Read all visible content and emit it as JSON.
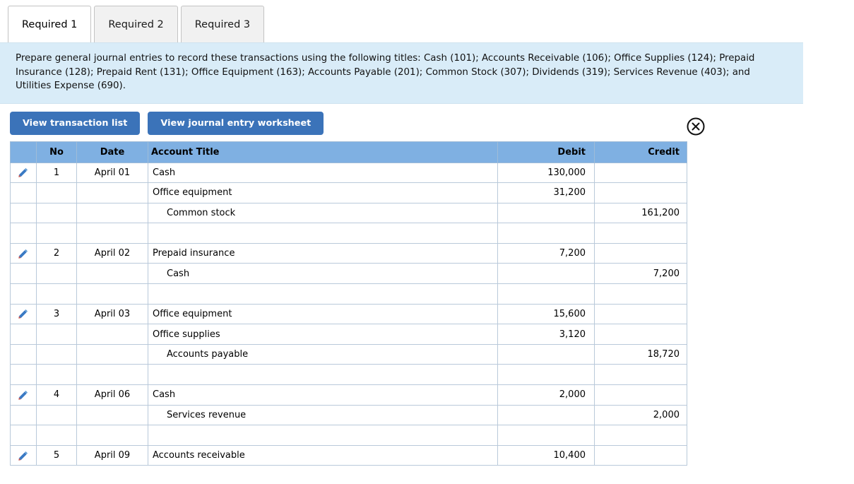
{
  "tabs": [
    {
      "label": "Required 1",
      "active": true
    },
    {
      "label": "Required 2",
      "active": false
    },
    {
      "label": "Required 3",
      "active": false
    }
  ],
  "instructions": {
    "text": "Prepare general journal entries to record these transactions using the following titles: Cash (101); Accounts Receivable (106); Office Supplies (124); Prepaid Insurance (128); Prepaid Rent (131); Office Equipment (163); Accounts Payable (201); Common Stock (307); Dividends (319); Services Revenue (403); and Utilities Expense (690)."
  },
  "toolbar": {
    "view_transaction_list_label": "View transaction list",
    "view_journal_entry_worksheet_label": "View journal entry worksheet",
    "close_icon": "circle-x-icon"
  },
  "table": {
    "headers": {
      "no": "No",
      "date": "Date",
      "account_title": "Account Title",
      "debit": "Debit",
      "credit": "Credit"
    },
    "row_icon": "pencil-icon",
    "rows": [
      {
        "icon": true,
        "no": "1",
        "date": "April 01",
        "title": "Cash",
        "indent": false,
        "debit": "130,000",
        "credit": ""
      },
      {
        "icon": false,
        "no": "",
        "date": "",
        "title": "Office equipment",
        "indent": false,
        "debit": "31,200",
        "credit": ""
      },
      {
        "icon": false,
        "no": "",
        "date": "",
        "title": "Common stock",
        "indent": true,
        "debit": "",
        "credit": "161,200"
      },
      {
        "icon": false,
        "no": "",
        "date": "",
        "title": "",
        "indent": false,
        "debit": "",
        "credit": ""
      },
      {
        "icon": true,
        "no": "2",
        "date": "April 02",
        "title": "Prepaid insurance",
        "indent": false,
        "debit": "7,200",
        "credit": ""
      },
      {
        "icon": false,
        "no": "",
        "date": "",
        "title": "Cash",
        "indent": true,
        "debit": "",
        "credit": "7,200"
      },
      {
        "icon": false,
        "no": "",
        "date": "",
        "title": "",
        "indent": false,
        "debit": "",
        "credit": ""
      },
      {
        "icon": true,
        "no": "3",
        "date": "April 03",
        "title": "Office equipment",
        "indent": false,
        "debit": "15,600",
        "credit": ""
      },
      {
        "icon": false,
        "no": "",
        "date": "",
        "title": "Office supplies",
        "indent": false,
        "debit": "3,120",
        "credit": ""
      },
      {
        "icon": false,
        "no": "",
        "date": "",
        "title": "Accounts payable",
        "indent": true,
        "debit": "",
        "credit": "18,720"
      },
      {
        "icon": false,
        "no": "",
        "date": "",
        "title": "",
        "indent": false,
        "debit": "",
        "credit": ""
      },
      {
        "icon": true,
        "no": "4",
        "date": "April 06",
        "title": "Cash",
        "indent": false,
        "debit": "2,000",
        "credit": ""
      },
      {
        "icon": false,
        "no": "",
        "date": "",
        "title": "Services revenue",
        "indent": true,
        "debit": "",
        "credit": "2,000"
      },
      {
        "icon": false,
        "no": "",
        "date": "",
        "title": "",
        "indent": false,
        "debit": "",
        "credit": ""
      },
      {
        "icon": true,
        "no": "5",
        "date": "April 09",
        "title": "Accounts receivable",
        "indent": false,
        "debit": "10,400",
        "credit": ""
      }
    ]
  },
  "colors": {
    "button_blue": "#3b73b9",
    "header_blue": "#7fb0e2",
    "panel_blue": "#d9ecf8",
    "pencil_blue": "#3a7ac4"
  }
}
